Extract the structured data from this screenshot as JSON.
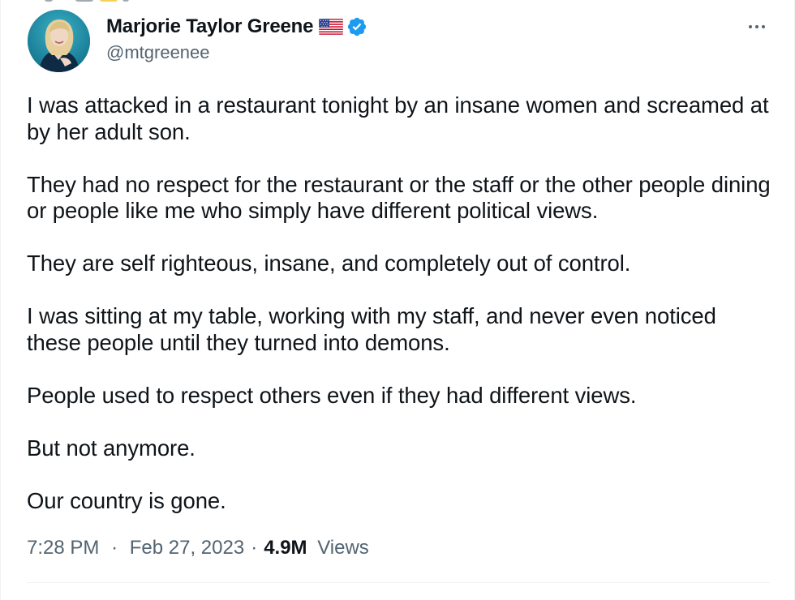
{
  "author": {
    "display_name": "Marjorie Taylor Greene",
    "handle": "@mtgreenee",
    "avatar_icon": "profile-photo",
    "flag_icon": "us-flag-icon",
    "verified_icon": "verified-badge-icon",
    "verified_color": "#1d9bf0"
  },
  "menu": {
    "more_icon": "more-options-icon"
  },
  "tweet": {
    "paragraphs": [
      "I was attacked in a restaurant tonight by an insane women and screamed at by her adult son.",
      "They had no respect for the restaurant or the staff or the other people dining or people like me who simply have different political views.",
      "They are self righteous, insane, and completely out of control.",
      "I was sitting at my table, working with my staff, and never even noticed these people until they turned into demons.",
      "People used to respect others even if they had different views.",
      "But not anymore.",
      "Our country is gone."
    ]
  },
  "meta": {
    "time": "7:28 PM",
    "separator": "·",
    "date": "Feb 27, 2023",
    "views_count": "4.9M",
    "views_label": "Views"
  },
  "colors": {
    "text_primary": "#0f1419",
    "text_secondary": "#536471",
    "divider": "#eff3f4"
  }
}
